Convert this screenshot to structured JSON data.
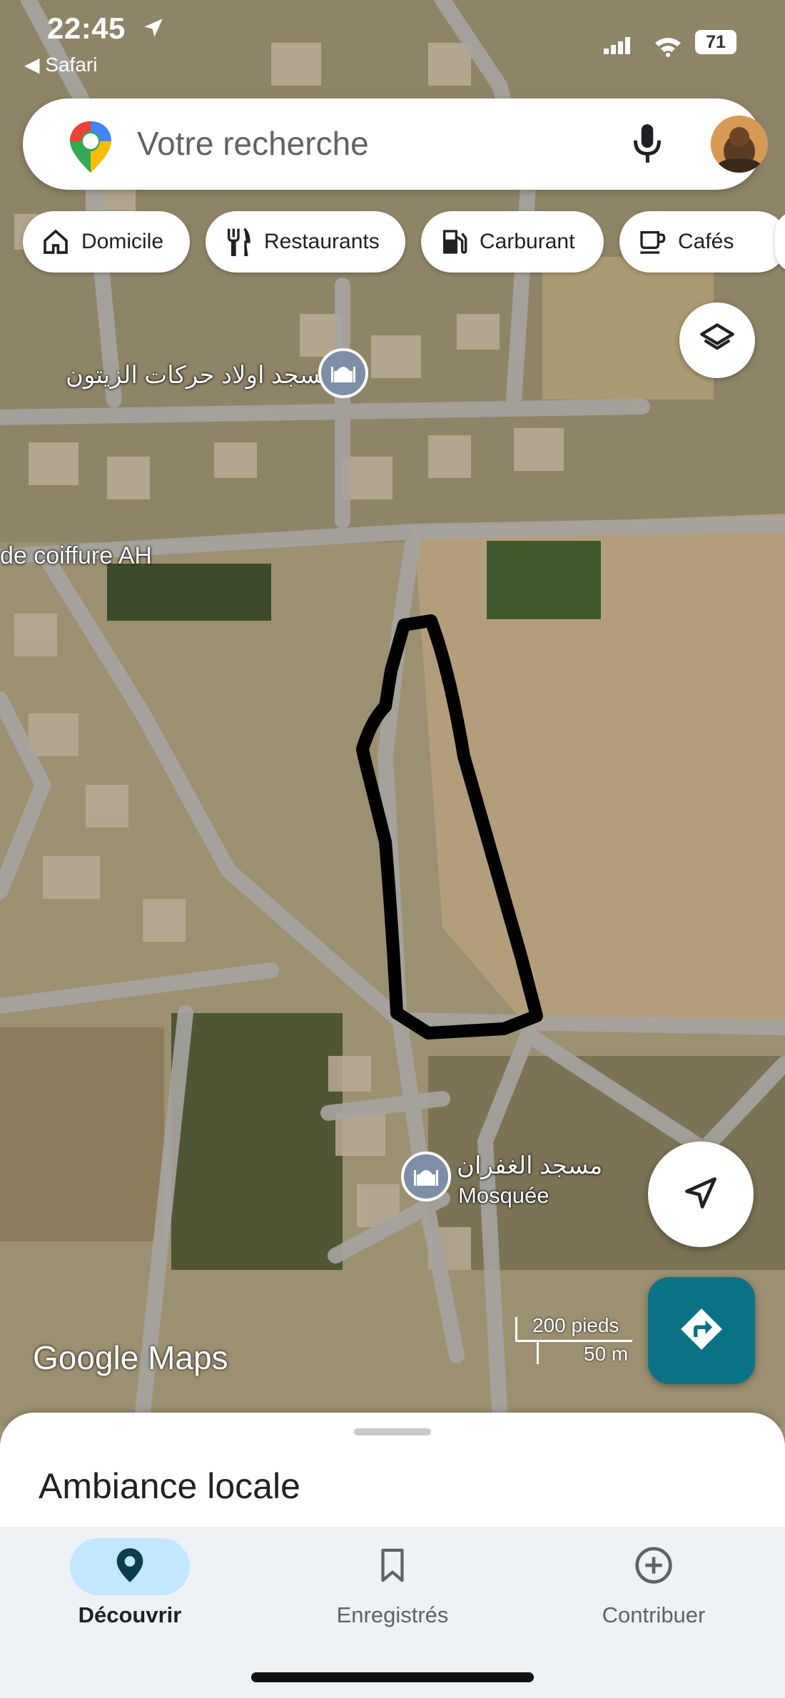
{
  "status_bar": {
    "time": "22:45",
    "back_app": "◀ Safari",
    "battery": "71"
  },
  "search": {
    "placeholder": "Votre recherche"
  },
  "chips": [
    {
      "label": "Domicile",
      "icon": "home-icon"
    },
    {
      "label": "Restaurants",
      "icon": "fork-knife-icon"
    },
    {
      "label": "Carburant",
      "icon": "fuel-pump-icon"
    },
    {
      "label": "Cafés",
      "icon": "coffee-cup-icon"
    }
  ],
  "map": {
    "label_mosque_top": "مسجد اولاد حركات الزيتون",
    "label_coiffure": "de coiffure AH",
    "label_mosque_bottom_name": "مسجد الغفران",
    "label_mosque_bottom_type": "Mosquée",
    "scale_feet": "200 pieds",
    "scale_meters": "50 m",
    "branding": "Google Maps",
    "drawn_outline_color": "#000000"
  },
  "sheet": {
    "title": "Ambiance locale"
  },
  "nav": [
    {
      "label": "Découvrir",
      "icon": "location-pin-icon",
      "active": true
    },
    {
      "label": "Enregistrés",
      "icon": "bookmark-icon",
      "active": false
    },
    {
      "label": "Contribuer",
      "icon": "add-circle-icon",
      "active": false
    }
  ],
  "colors": {
    "accent_teal": "#0b7285",
    "active_pill": "#c2e7ff"
  }
}
